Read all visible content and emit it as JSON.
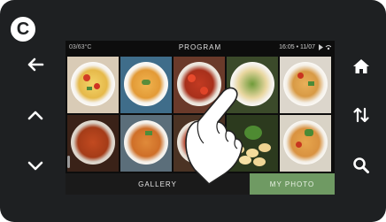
{
  "badge": {
    "letter": "C"
  },
  "left_buttons": [
    {
      "name": "back-arrow-icon",
      "glyph": "←"
    },
    {
      "name": "chevron-up-icon",
      "glyph": "^"
    },
    {
      "name": "chevron-down-icon",
      "glyph": "⌄"
    }
  ],
  "right_buttons": [
    {
      "name": "home-icon"
    },
    {
      "name": "sort-icon"
    },
    {
      "name": "search-icon"
    }
  ],
  "status": {
    "temperature": "03/63°C",
    "title": "PROGRAM",
    "time": "16:05 • 11/07"
  },
  "tabs": {
    "gallery": "GALLERY",
    "my_photo": "MY PHOTO"
  },
  "colors": {
    "device": "#1e2022",
    "active_tab": "#6f9a63"
  }
}
